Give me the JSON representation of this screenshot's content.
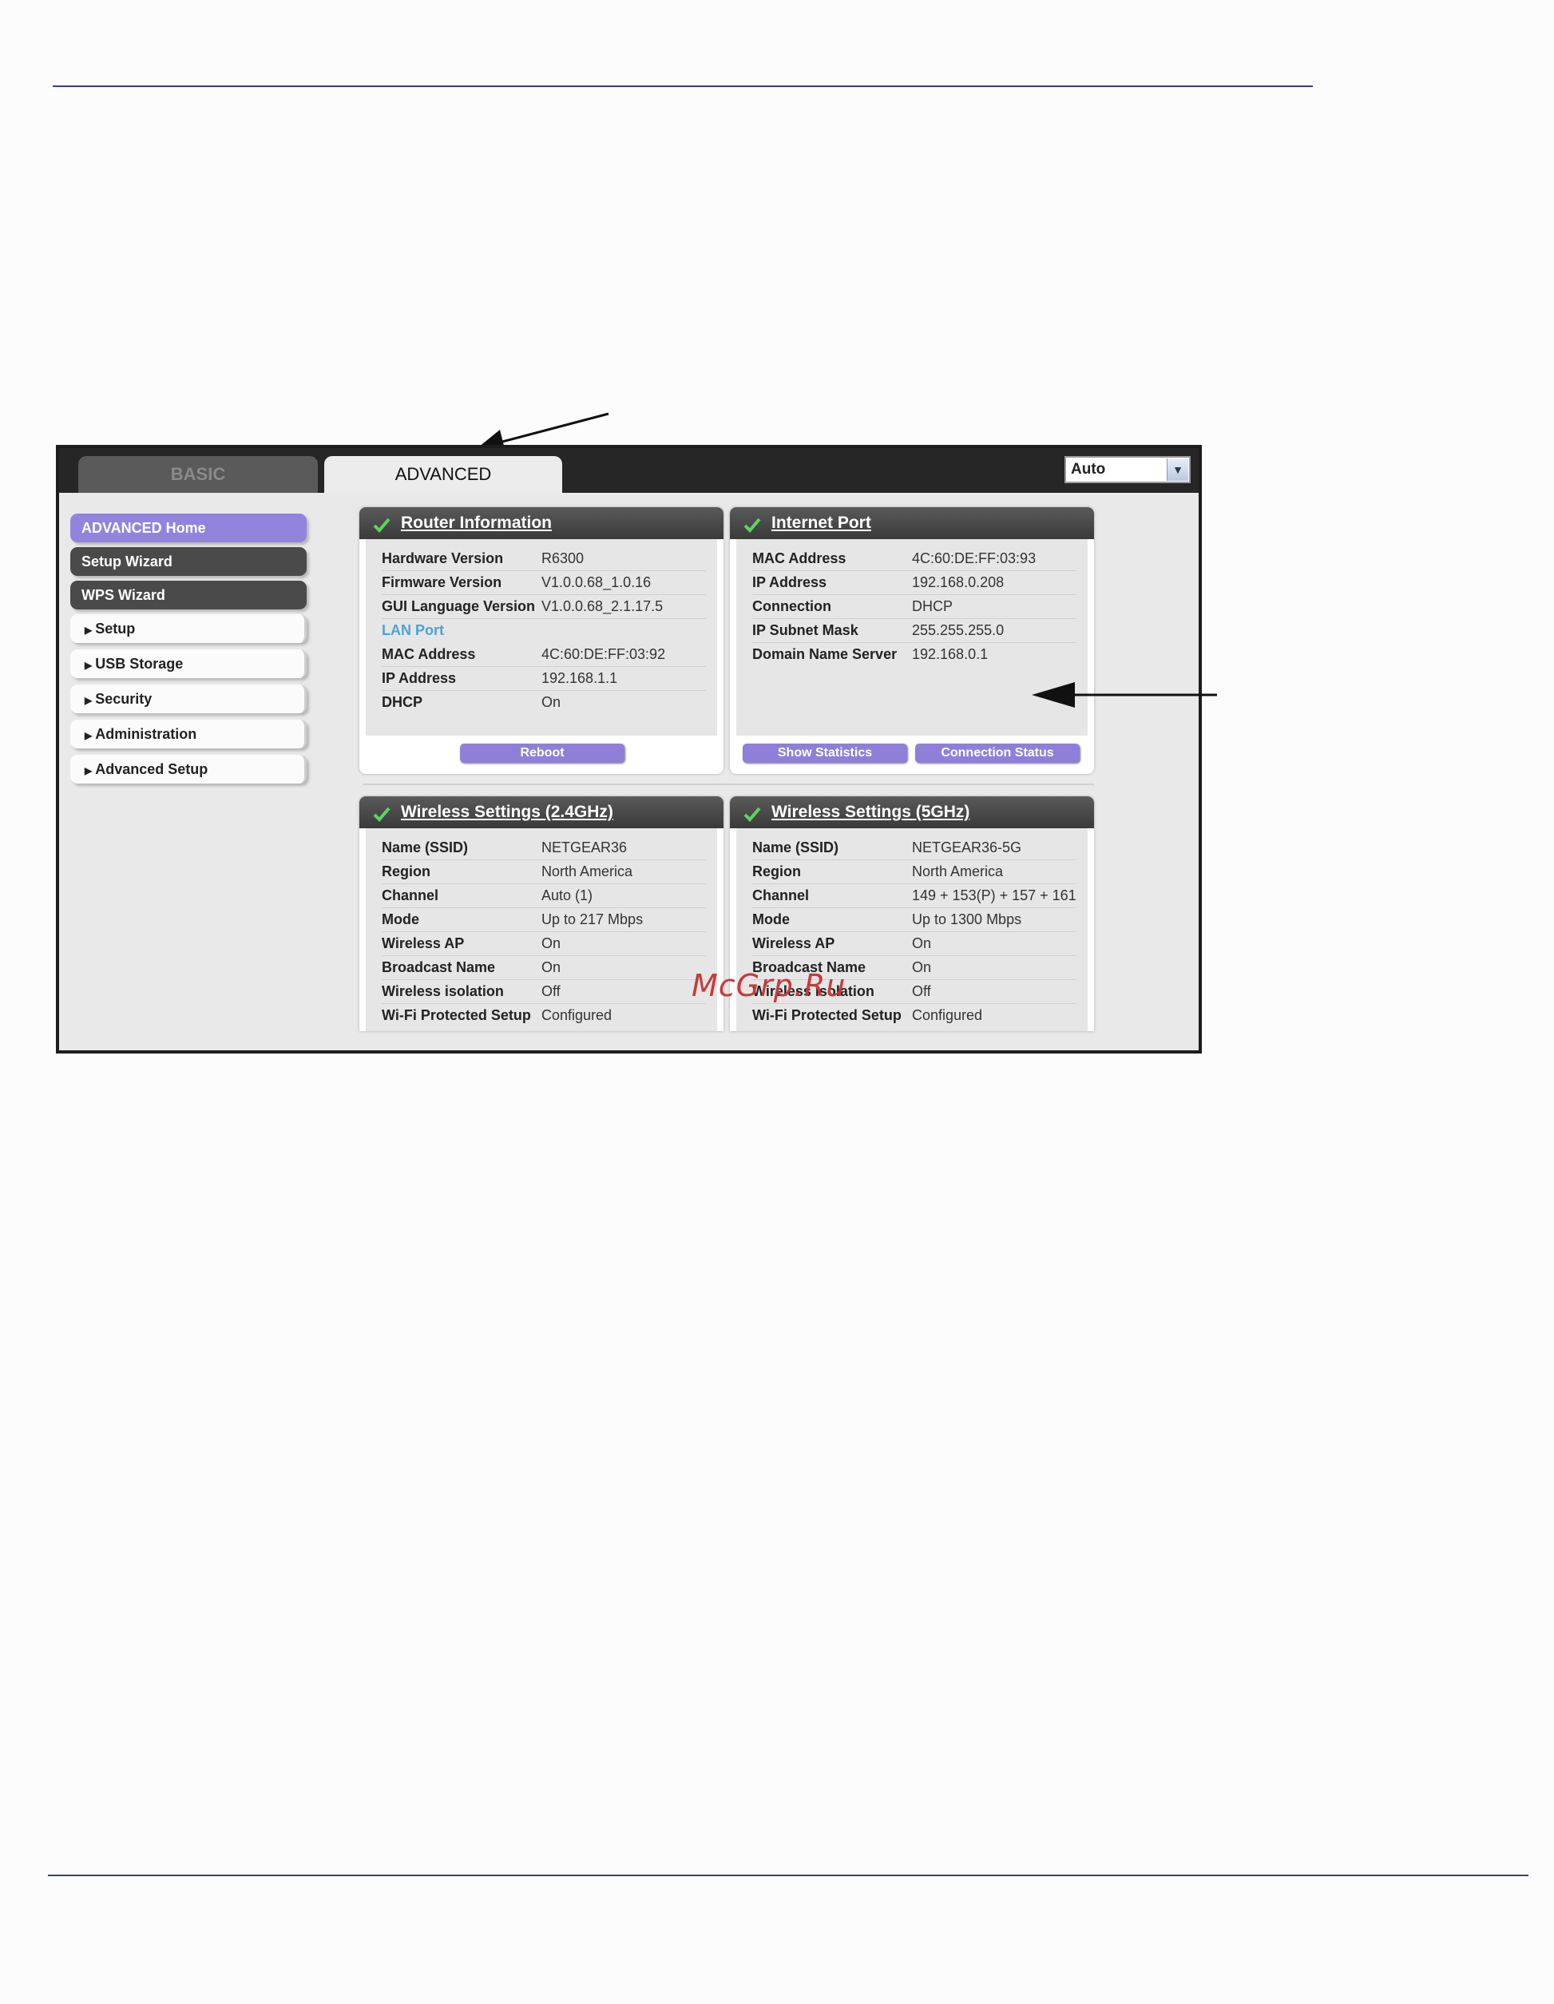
{
  "tabs": {
    "basic": "BASIC",
    "advanced": "ADVANCED"
  },
  "language_select": {
    "value": "Auto"
  },
  "sidebar": {
    "items": [
      {
        "label": "ADVANCED Home",
        "style": "active"
      },
      {
        "label": "Setup Wizard",
        "style": "dark"
      },
      {
        "label": "WPS Wizard",
        "style": "dark"
      },
      {
        "label": "Setup",
        "style": "light"
      },
      {
        "label": "USB Storage",
        "style": "light"
      },
      {
        "label": "Security",
        "style": "light"
      },
      {
        "label": "Administration",
        "style": "light"
      },
      {
        "label": "Advanced Setup",
        "style": "light"
      }
    ]
  },
  "router_info": {
    "title": "Router Information",
    "rows": [
      {
        "k": "Hardware Version",
        "v": "R6300"
      },
      {
        "k": "Firmware Version",
        "v": "V1.0.0.68_1.0.16"
      },
      {
        "k": "GUI Language Version",
        "v": "V1.0.0.68_2.1.17.5"
      },
      {
        "k": "LAN Port",
        "v": ""
      },
      {
        "k": "MAC Address",
        "v": "4C:60:DE:FF:03:92"
      },
      {
        "k": "IP Address",
        "v": "192.168.1.1"
      },
      {
        "k": "DHCP",
        "v": "On"
      }
    ],
    "reboot_label": "Reboot"
  },
  "internet_port": {
    "title": "Internet Port",
    "rows": [
      {
        "k": "MAC Address",
        "v": "4C:60:DE:FF:03:93"
      },
      {
        "k": "IP Address",
        "v": "192.168.0.208"
      },
      {
        "k": "Connection",
        "v": "DHCP"
      },
      {
        "k": "IP Subnet Mask",
        "v": "255.255.255.0"
      },
      {
        "k": "Domain Name Server",
        "v": "192.168.0.1"
      }
    ],
    "stats_label": "Show Statistics",
    "status_label": "Connection Status"
  },
  "wireless_24": {
    "title": "Wireless Settings (2.4GHz)",
    "rows": [
      {
        "k": "Name (SSID)",
        "v": "NETGEAR36"
      },
      {
        "k": "Region",
        "v": "North America"
      },
      {
        "k": "Channel",
        "v": "Auto (1)"
      },
      {
        "k": "Mode",
        "v": "Up to 217 Mbps"
      },
      {
        "k": "Wireless AP",
        "v": "On"
      },
      {
        "k": "Broadcast Name",
        "v": "On"
      },
      {
        "k": "Wireless isolation",
        "v": "Off"
      },
      {
        "k": "Wi-Fi Protected Setup",
        "v": "Configured"
      }
    ]
  },
  "wireless_5": {
    "title": "Wireless Settings (5GHz)",
    "rows": [
      {
        "k": "Name (SSID)",
        "v": "NETGEAR36-5G"
      },
      {
        "k": "Region",
        "v": "North America"
      },
      {
        "k": "Channel",
        "v": "149 + 153(P) + 157 + 161"
      },
      {
        "k": "Mode",
        "v": "Up to 1300 Mbps"
      },
      {
        "k": "Wireless AP",
        "v": "On"
      },
      {
        "k": "Broadcast Name",
        "v": "On"
      },
      {
        "k": "Wireless isolation",
        "v": "Off"
      },
      {
        "k": "Wi-Fi Protected Setup",
        "v": "Configured"
      }
    ]
  },
  "watermark": "McGrp.Ru"
}
